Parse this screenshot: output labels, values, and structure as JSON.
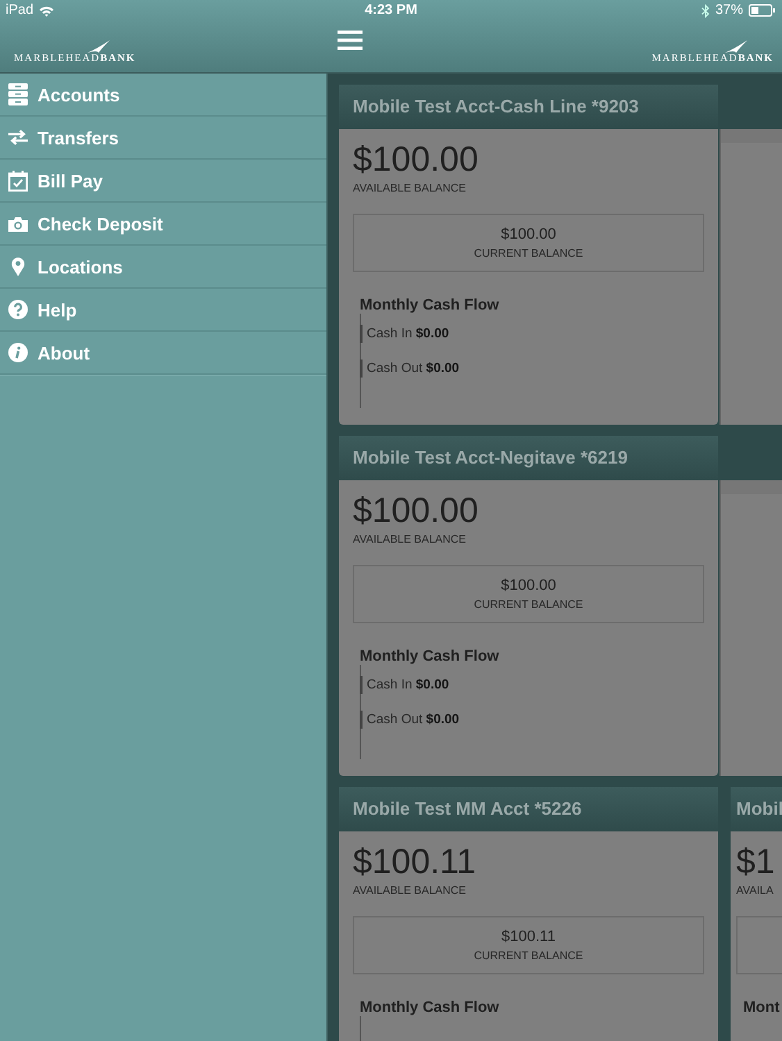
{
  "status_bar": {
    "device": "iPad",
    "time": "4:23 PM",
    "battery": "37%"
  },
  "header": {
    "logo_left": "MARBLEHEAD**BANK**",
    "logo_right": "MARBLEHEAD**BANK**"
  },
  "sidebar": {
    "items": [
      {
        "label": "Accounts"
      },
      {
        "label": "Transfers"
      },
      {
        "label": "Bill Pay"
      },
      {
        "label": "Check Deposit"
      },
      {
        "label": "Locations"
      },
      {
        "label": "Help"
      },
      {
        "label": "About"
      }
    ]
  },
  "accounts": [
    {
      "title": "Mobile Test Acct-Cash Line *9203",
      "available": "$100.00",
      "available_label": "AVAILABLE BALANCE",
      "current": "$100.00",
      "current_label": "CURRENT BALANCE",
      "flow_title": "Monthly Cash Flow",
      "cash_in_label": "Cash In",
      "cash_in": "$0.00",
      "cash_out_label": "Cash Out",
      "cash_out": "$0.00",
      "peek": {
        "kind": "blank"
      }
    },
    {
      "title": "Mobile Test Acct-Negitave *6219",
      "available": "$100.00",
      "available_label": "AVAILABLE BALANCE",
      "current": "$100.00",
      "current_label": "CURRENT BALANCE",
      "flow_title": "Monthly Cash Flow",
      "cash_in_label": "Cash In",
      "cash_in": "$0.00",
      "cash_out_label": "Cash Out",
      "cash_out": "$0.00",
      "peek": {
        "kind": "blank"
      }
    },
    {
      "title": "Mobile Test MM Acct *5226",
      "available": "$100.11",
      "available_label": "AVAILABLE BALANCE",
      "current": "$100.11",
      "current_label": "CURRENT BALANCE",
      "flow_title": "Monthly Cash Flow",
      "peek": {
        "kind": "card",
        "title": "Mobil",
        "available": "$1",
        "available_label": "AVAILA",
        "flow_title": "Mont"
      }
    }
  ]
}
